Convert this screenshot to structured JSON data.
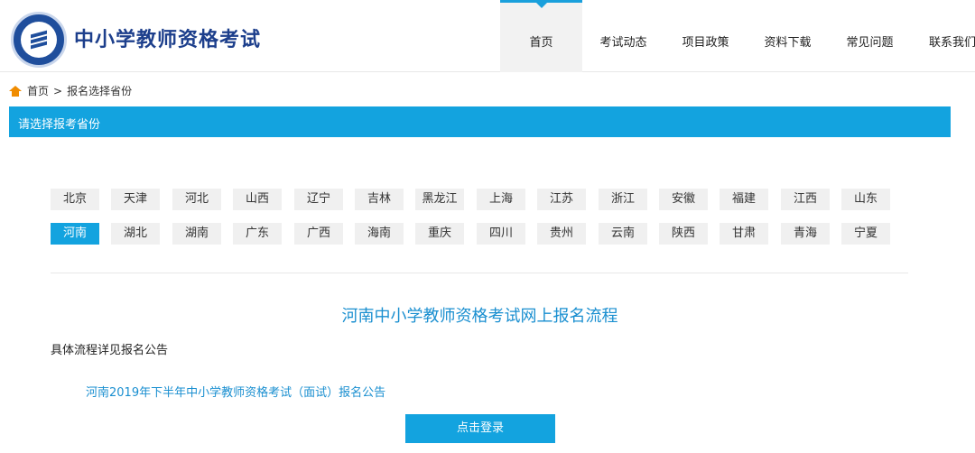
{
  "site": {
    "title": "中小学教师资格考试"
  },
  "nav": {
    "items": [
      {
        "label": "首页",
        "active": true
      },
      {
        "label": "考试动态",
        "active": false
      },
      {
        "label": "项目政策",
        "active": false
      },
      {
        "label": "资料下载",
        "active": false
      },
      {
        "label": "常见问题",
        "active": false
      },
      {
        "label": "联系我们",
        "active": false
      }
    ]
  },
  "breadcrumb": {
    "home": "首页",
    "separator": ">",
    "current": "报名选择省份"
  },
  "section": {
    "title": "请选择报考省份"
  },
  "provinces": {
    "row1": [
      "北京",
      "天津",
      "河北",
      "山西",
      "辽宁",
      "吉林",
      "黑龙江",
      "上海",
      "江苏",
      "浙江",
      "安徽",
      "福建",
      "江西",
      "山东"
    ],
    "row2": [
      "河南",
      "湖北",
      "湖南",
      "广东",
      "广西",
      "海南",
      "重庆",
      "四川",
      "贵州",
      "云南",
      "陕西",
      "甘肃",
      "青海",
      "宁夏"
    ],
    "selected": "河南"
  },
  "flow": {
    "title": "河南中小学教师资格考试网上报名流程",
    "desc": "具体流程详见报名公告",
    "notice_link": "河南2019年下半年中小学教师资格考试（面试）报名公告",
    "login_button": "点击登录"
  },
  "colors": {
    "accent": "#13a3df",
    "brand": "#1d3f8c",
    "home_icon": "#f08c00"
  }
}
